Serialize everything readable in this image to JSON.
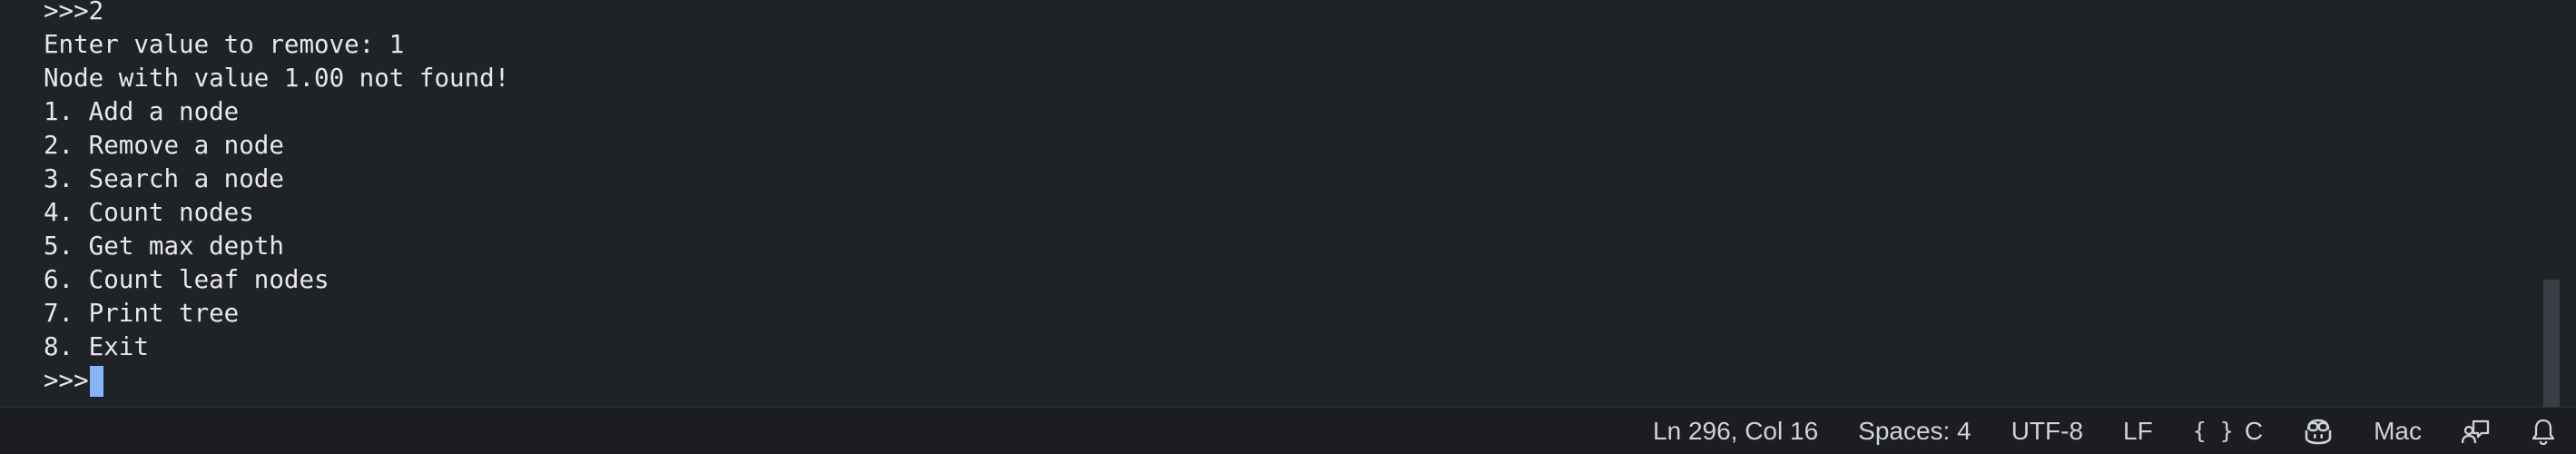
{
  "terminal": {
    "lines": [
      ">>>2",
      "Enter value to remove: 1",
      "Node with value 1.00 not found!",
      "1. Add a node",
      "2. Remove a node",
      "3. Search a node",
      "4. Count nodes",
      "5. Get max depth",
      "6. Count leaf nodes",
      "7. Print tree",
      "8. Exit"
    ],
    "prompt": ">>>",
    "cursor_color": "#88b4f8"
  },
  "statusbar": {
    "cursor_position": "Ln 296, Col 16",
    "indentation": "Spaces: 4",
    "encoding": "UTF-8",
    "line_ending": "LF",
    "language_icon": "{ }",
    "language": "C",
    "copilot_icon": "copilot-icon",
    "profile": "Mac",
    "feedback_icon": "feedback-icon",
    "notifications_icon": "bell-icon"
  },
  "colors": {
    "background": "#1f2227",
    "text": "#e8e8e8",
    "statusbar_bg": "#1b1d21",
    "statusbar_text": "#cfd2d6"
  }
}
